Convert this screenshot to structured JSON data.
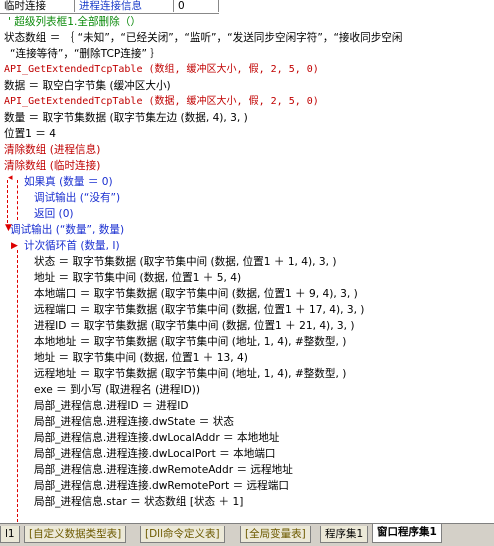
{
  "top_table": {
    "cells": [
      "临时连接",
      "进程连接信息",
      "0"
    ]
  },
  "code_lines": [
    {
      "text": "' 超级列表框1.全部删除（）",
      "color": "c-green",
      "x": 8
    },
    {
      "text": "状态数组 ＝ ｛ “未知”，“已经关闭”，“监听”，“发送同步空闲字符”，“接收同步空闲",
      "color": "c-black",
      "x": 4
    },
    {
      "text": "“连接等待”，“删除TCP连接” ｝",
      "color": "c-black",
      "x": 10
    },
    {
      "text": "API_GetExtendedTcpTable (数组, 缓冲区大小, 假, 2, 5, 0)",
      "color": "c-red",
      "x": 4,
      "api": true
    },
    {
      "text": "数据 ＝ 取空白字节集 (缓冲区大小)",
      "color": "c-black",
      "x": 4
    },
    {
      "text": "API_GetExtendedTcpTable (数据, 缓冲区大小, 假, 2, 5, 0)",
      "color": "c-red",
      "x": 4,
      "api": true
    },
    {
      "text": "数量 ＝ 取字节集数据 (取字节集左边 (数据, 4), 3, )",
      "color": "c-black",
      "x": 4
    },
    {
      "text": "位置1 ＝ 4",
      "color": "c-black",
      "x": 4
    },
    {
      "text": "清除数组 (进程信息)",
      "color": "c-red",
      "x": 4
    },
    {
      "text": "清除数组 (临时连接)",
      "color": "c-red",
      "x": 4
    },
    {
      "text": "如果真 (数量 ＝ 0)",
      "color": "c-blue",
      "x": 24
    },
    {
      "text": "调试输出 (“没有”)",
      "color": "c-blue",
      "x": 34
    },
    {
      "text": "返回 (0)",
      "color": "c-blue",
      "x": 34
    },
    {
      "text": "调试输出 (“数量”, 数量)",
      "color": "c-blue",
      "x": 10
    },
    {
      "text": "计次循环首 (数量, I)",
      "color": "c-blue",
      "x": 24
    },
    {
      "text": "状态 ＝ 取字节集数据 (取字节集中间 (数据, 位置1 ＋ 1, 4), 3, )",
      "color": "c-black",
      "x": 34
    },
    {
      "text": "地址 ＝ 取字节集中间 (数据, 位置1 ＋ 5, 4)",
      "color": "c-black",
      "x": 34
    },
    {
      "text": "本地端口 ＝ 取字节集数据 (取字节集中间 (数据, 位置1 ＋ 9, 4), 3, )",
      "color": "c-black",
      "x": 34
    },
    {
      "text": "远程端口 ＝ 取字节集数据 (取字节集中间 (数据, 位置1 ＋ 17, 4), 3, )",
      "color": "c-black",
      "x": 34
    },
    {
      "text": "进程ID ＝ 取字节集数据 (取字节集中间 (数据, 位置1 ＋ 21, 4), 3, )",
      "color": "c-black",
      "x": 34
    },
    {
      "text": "本地地址 ＝ 取字节集数据 (取字节集中间 (地址, 1, 4), #整数型, )",
      "color": "c-black",
      "x": 34
    },
    {
      "text": "地址 ＝ 取字节集中间 (数据, 位置1 ＋ 13, 4)",
      "color": "c-black",
      "x": 34
    },
    {
      "text": "远程地址 ＝ 取字节集数据 (取字节集中间 (地址, 1, 4), #整数型, )",
      "color": "c-black",
      "x": 34
    },
    {
      "text": "exe ＝ 到小写 (取进程名 (进程ID))",
      "color": "c-black",
      "x": 34
    },
    {
      "text": "局部_进程信息.进程ID ＝ 进程ID",
      "color": "c-black",
      "x": 34
    },
    {
      "text": "局部_进程信息.进程连接.dwState ＝ 状态",
      "color": "c-black",
      "x": 34
    },
    {
      "text": "局部_进程信息.进程连接.dwLocalAddr ＝ 本地地址",
      "color": "c-black",
      "x": 34
    },
    {
      "text": "局部_进程信息.进程连接.dwLocalPort ＝ 本地端口",
      "color": "c-black",
      "x": 34
    },
    {
      "text": "局部_进程信息.进程连接.dwRemoteAddr ＝ 远程地址",
      "color": "c-black",
      "x": 34
    },
    {
      "text": "局部_进程信息.进程连接.dwRemotePort ＝ 远程端口",
      "color": "c-black",
      "x": 34
    },
    {
      "text": "局部_进程信息.star ＝ 状态数组 [状态 ＋ 1]",
      "color": "c-black",
      "x": 34
    }
  ],
  "tabs": [
    {
      "label": "l1",
      "style": "plain"
    },
    {
      "label": "[自定义数据类型表]",
      "style": ""
    },
    {
      "label": "[Dll命令定义表]",
      "style": ""
    },
    {
      "label": "[全局变量表]",
      "style": ""
    },
    {
      "label": "程序集1",
      "style": "plain"
    },
    {
      "label": "窗口程序集1",
      "style": "active"
    }
  ],
  "colors": {
    "keyword_blue": "#1a2fd0",
    "api_red": "#c00000",
    "comment_green": "#0a8a0a",
    "tab_text": "#6d5a00"
  }
}
